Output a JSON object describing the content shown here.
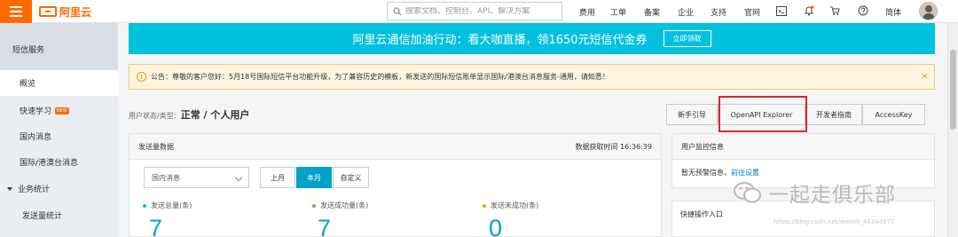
{
  "topbar": {
    "logo_text": "阿里云",
    "search_placeholder": "搜索文档、控制台、API、解决方案",
    "nav_items": [
      "费用",
      "工单",
      "备案",
      "企业",
      "支持",
      "官网"
    ],
    "language": "简体",
    "icons": [
      "menu-icon",
      "search-icon",
      "terminal-icon",
      "bell-icon",
      "cart-icon",
      "help-icon",
      "avatar"
    ],
    "brand_color": "#ff6a00"
  },
  "sidebar": {
    "title": "短信服务",
    "items": [
      {
        "label": "概览",
        "active": true
      },
      {
        "label": "快速学习",
        "badge": "NEW"
      },
      {
        "label": "国内消息"
      },
      {
        "label": "国际/港澳台消息"
      }
    ],
    "group": {
      "label": "业务统计",
      "children": [
        {
          "label": "发送量统计"
        }
      ]
    }
  },
  "banner": {
    "text": "阿里云通信加油行动：看大咖直播，领1650元短信代金券",
    "button": "立即领取",
    "color": "#00c1de"
  },
  "notice": {
    "text": "公告：尊敬的客户您好：5月18号国际短信平台功能升级，为了兼容历史的模板，新发送的国际短信账单显示国际/港澳台消息服务-通用，请知悉！",
    "close": "×"
  },
  "status": {
    "label": "用户状态/类型：",
    "value": "正常 / 个人用户"
  },
  "tabs": [
    "新手引导",
    "OpenAPI Explorer",
    "开发者指南",
    "AccessKey"
  ],
  "send_panel": {
    "title": "发送量数据",
    "fetch_time": "数据获取时间 16:36:39",
    "select_value": "国内消息",
    "periods": [
      {
        "label": "上月",
        "active": false
      },
      {
        "label": "本月",
        "active": true
      },
      {
        "label": "自定义",
        "active": false
      }
    ],
    "stats": [
      {
        "label": "发送总量(条)",
        "value": "7",
        "color": "#00c1de"
      },
      {
        "label": "发送成功量(条)",
        "value": "7",
        "color": "#5cb85c"
      },
      {
        "label": "发送未成功(条)",
        "value": "0",
        "color": "#f39c12"
      }
    ]
  },
  "monitor_panel": {
    "title": "用户监控信息",
    "text": "暂无预警信息，",
    "link": "前往设置"
  },
  "quick_panel": {
    "title": "快捷操作入口"
  },
  "watermark": {
    "text": "一起走俱乐部",
    "url": "https://blog.csdn.net/weixin_48344977"
  }
}
